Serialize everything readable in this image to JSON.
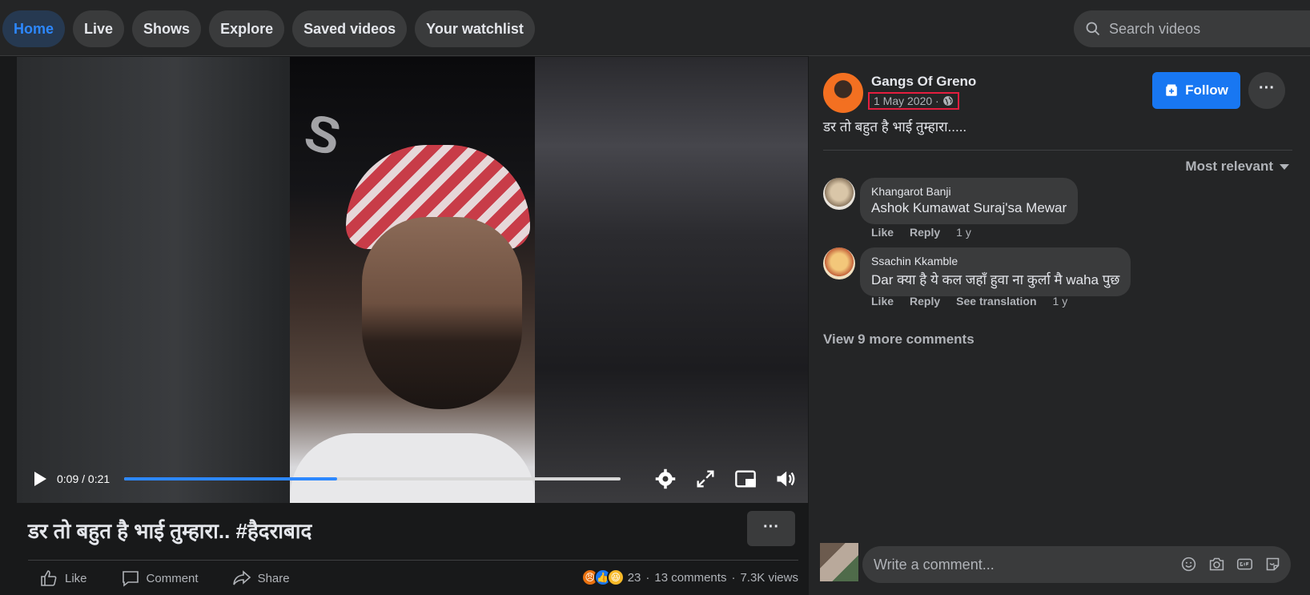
{
  "nav": {
    "tabs": [
      {
        "label": "Home",
        "active": true
      },
      {
        "label": "Live"
      },
      {
        "label": "Shows"
      },
      {
        "label": "Explore"
      },
      {
        "label": "Saved videos"
      },
      {
        "label": "Your watchlist"
      }
    ],
    "search_placeholder": "Search videos"
  },
  "player": {
    "time": "0:09 / 0:21",
    "progress_fraction": 0.4286
  },
  "video": {
    "title": "डर तो बहुत है भाई तुम्हारा.. #हैदराबाद",
    "actions": {
      "like": "Like",
      "comment": "Comment",
      "share": "Share"
    },
    "reaction_count": "23",
    "comments_count": "13 comments",
    "views": "7.3K views",
    "separator": "·"
  },
  "post": {
    "author": "Gangs Of Greno",
    "date": "1 May 2020 ·",
    "follow_label": "Follow",
    "caption": "डर तो बहुत है भाई तुम्हारा.....",
    "sort_label": "Most relevant"
  },
  "comments": [
    {
      "name": "Khangarot Banji",
      "text": "Ashok Kumawat Suraj'sa Mewar",
      "like": "Like",
      "reply": "Reply",
      "time": "1 y"
    },
    {
      "name": "Ssachin Kkamble",
      "text": "Dar क्या है ये कल जहाँ हुवा ना कुर्ला मै waha पुछ",
      "like": "Like",
      "reply": "Reply",
      "translate": "See translation",
      "time": "1 y"
    }
  ],
  "view_more": "View 9 more comments",
  "composer": {
    "placeholder": "Write a comment..."
  },
  "colors": {
    "accent": "#1877f2",
    "progress": "#2d88ff",
    "date_highlight": "#e41e3f"
  }
}
